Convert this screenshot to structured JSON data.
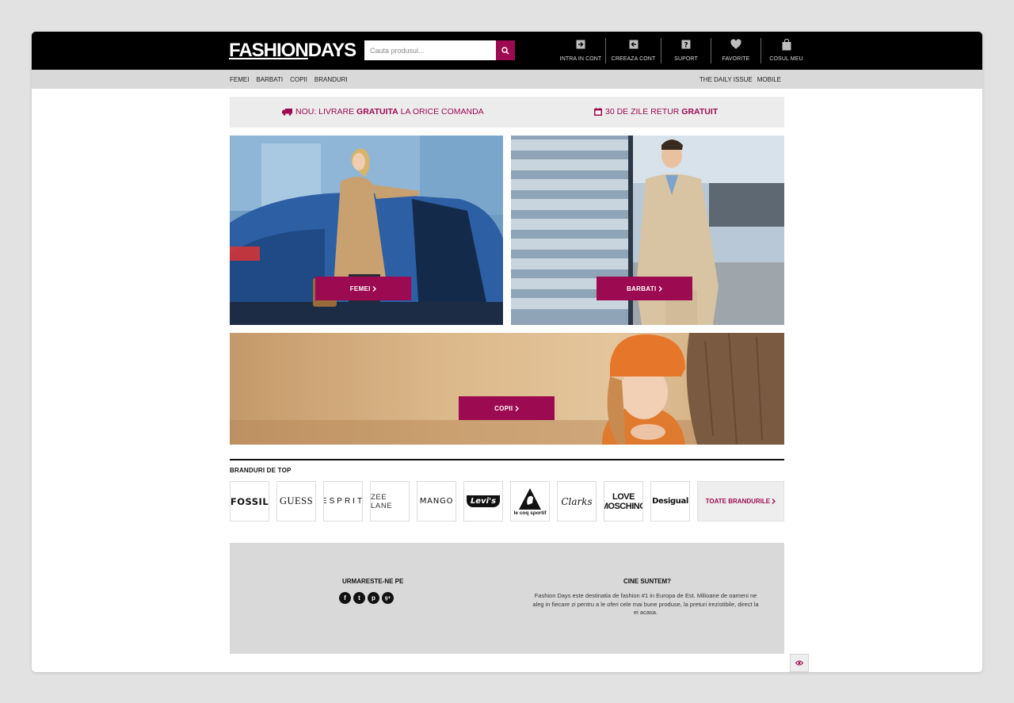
{
  "header": {
    "logo_left": "FASHION",
    "logo_right": "DAYS",
    "search": {
      "placeholder": "Cauta produsul..."
    },
    "account_menu": [
      {
        "label": "INTRA IN CONT",
        "icon": "login-icon"
      },
      {
        "label": "CREEAZA CONT",
        "icon": "create-account-icon"
      },
      {
        "label": "SUPORT",
        "icon": "support-icon"
      },
      {
        "label": "FAVORITE",
        "icon": "heart-icon"
      },
      {
        "label": "COSUL MEU",
        "icon": "bag-icon"
      }
    ]
  },
  "subnav": {
    "left": [
      "FEMEI",
      "BARBATI",
      "COPII",
      "BRANDURI"
    ],
    "right": [
      "THE DAILY ISSUE",
      "MOBILE"
    ]
  },
  "promo": {
    "item1": {
      "prefix": "NOU: LIVRARE ",
      "bold": "GRATUITA",
      "suffix": " LA ORICE COMANDA",
      "icon": "truck-icon"
    },
    "item2": {
      "prefix": "30 DE ZILE RETUR ",
      "bold": "GRATUIT",
      "icon": "calendar-icon"
    }
  },
  "banners": {
    "women": {
      "cta": "FEMEI"
    },
    "men": {
      "cta": "BARBATI"
    },
    "kids": {
      "cta": "COPII"
    }
  },
  "brands": {
    "title": "BRANDURI DE TOP",
    "items": [
      "FOSSIL",
      "GUESS",
      "ESPRIT",
      "ZEE LANE",
      "MANGO",
      "Levi's",
      "le coq sportif",
      "Clarks",
      "LOVE MOSCHINO",
      "Desigual"
    ],
    "moschino_line1": "LOVE",
    "moschino_line2": "MOSCHINO",
    "all_label": "TOATE BRANDURILE"
  },
  "footer": {
    "follow_title": "URMARESTE-NE PE",
    "social": [
      {
        "glyph": "f",
        "icon": "facebook-icon"
      },
      {
        "glyph": "t",
        "icon": "twitter-icon"
      },
      {
        "glyph": "p",
        "icon": "pinterest-icon"
      },
      {
        "glyph": "g+",
        "icon": "google-plus-icon"
      }
    ],
    "about_title": "CINE SUNTEM?",
    "about_text": "Fashion Days este destinatia de fashion #1 in Europa de Est. Milioane de oameni ne aleg in fiecare zi pentru a le oferi cele mai bune produse, la preturi irezistibile, direct la ei acasa."
  },
  "colors": {
    "accent": "#9c0b52",
    "header_bg": "#000000",
    "subnav_bg": "#d9d9d9"
  }
}
